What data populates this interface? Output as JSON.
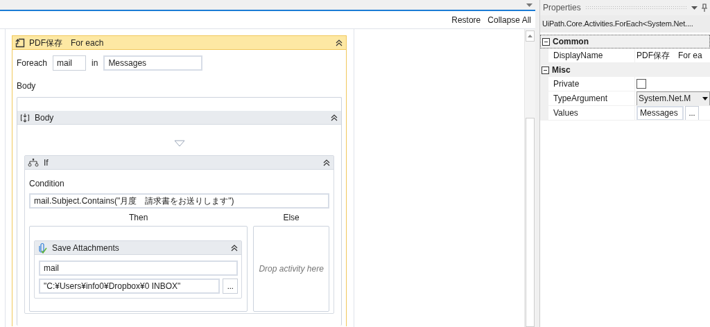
{
  "designer": {
    "toolbar": [
      {
        "label": "Restore"
      },
      {
        "label": "Collapse All"
      }
    ],
    "foreach": {
      "title": "PDF保存　For each",
      "expanded": true,
      "foreach_label": "Foreach",
      "item": "mail",
      "in_label": "in",
      "values": "Messages",
      "body_label": "Body",
      "body": {
        "title": "Body",
        "expanded": true,
        "if": {
          "title": "If",
          "expanded": true,
          "condition_label": "Condition",
          "condition": "mail.Subject.Contains(\"月度　請求書をお送りします\")",
          "then_label": "Then",
          "else_label": "Else",
          "else_placeholder": "Drop activity here",
          "then": {
            "title": "Save Attachments",
            "expanded": true,
            "message": "mail",
            "folder": "\"C:¥Users¥info0¥Dropbox¥0 INBOX\"",
            "browse": "..."
          }
        }
      }
    }
  },
  "properties": {
    "title": "Properties",
    "type": "UiPath.Core.Activities.ForEach<System.Net....",
    "categories": [
      {
        "name": "Common",
        "expanded": true,
        "rows": [
          {
            "kind": "text",
            "name": "DisplayName",
            "value": "PDF保存　For ea"
          }
        ]
      },
      {
        "name": "Misc",
        "expanded": true,
        "rows": [
          {
            "kind": "checkbox",
            "name": "Private",
            "checked": false
          },
          {
            "kind": "dropdown",
            "name": "TypeArgument",
            "value": "System.Net.M"
          },
          {
            "kind": "browse",
            "name": "Values",
            "value": "Messages",
            "button": "..."
          }
        ]
      }
    ]
  }
}
